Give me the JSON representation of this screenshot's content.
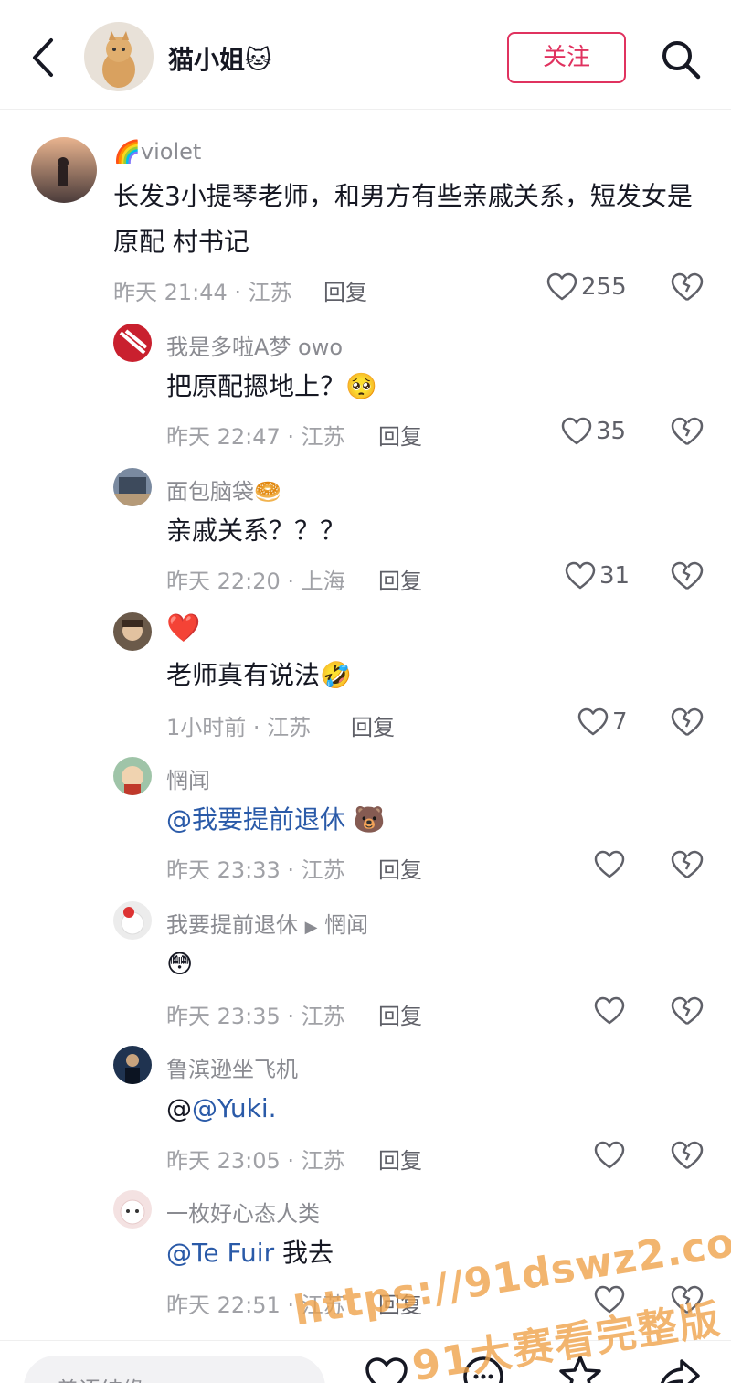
{
  "header": {
    "name": "猫小姐",
    "name_emoji": "🐱",
    "follow_label": "关注"
  },
  "comments": [
    {
      "name_emoji": "🌈",
      "name": "violet",
      "text": "长发3小提琴老师，和男方有些亲戚关系，短发女是原配 村书记",
      "meta": "昨天 21:44 · 江苏",
      "reply": "回复",
      "likes": "255"
    },
    {
      "name": "我是多啦A梦 owo",
      "text": "把原配摁地上？",
      "text_emoji": "🥺",
      "meta": "昨天 22:47 · 江苏",
      "reply": "回复",
      "likes": "35"
    },
    {
      "name": "面包脑袋",
      "name_emoji": "🥯",
      "text": "亲戚关系？？？",
      "meta": "昨天 22:20 · 上海",
      "reply": "回复",
      "likes": "31"
    },
    {
      "name_emoji": "❤️",
      "text": "老师真有说法",
      "text_emoji": "🤣",
      "meta": "1小时前 · 江苏",
      "reply": "回复",
      "likes": "7"
    },
    {
      "name": "惘闻",
      "mention": "@我要提前退休",
      "text_emoji": "🐻",
      "meta": "昨天 23:33 · 江苏",
      "reply": "回复"
    },
    {
      "name": "我要提前退休",
      "reply_to": "惘闻",
      "text_emoji": "😳",
      "meta": "昨天 23:35 · 江苏",
      "reply": "回复"
    },
    {
      "name": "鲁滨逊坐飞机",
      "text_prefix": "@",
      "mention": "@Yuki.",
      "meta": "昨天 23:05 · 江苏",
      "reply": "回复"
    },
    {
      "name": "一枚好心态人类",
      "mention": "@Te Fuir",
      "text": " 我去",
      "meta": "昨天 22:51 · 江苏",
      "reply": "回复"
    }
  ],
  "bottom": {
    "placeholder": "善语结缘..."
  },
  "watermark": {
    "line1": "https://91dswz2.com",
    "line2": "91大赛看完整版"
  },
  "colors": {
    "accent": "#e0325f",
    "mention": "#2a5aa8",
    "meta": "#a0a1a6"
  }
}
